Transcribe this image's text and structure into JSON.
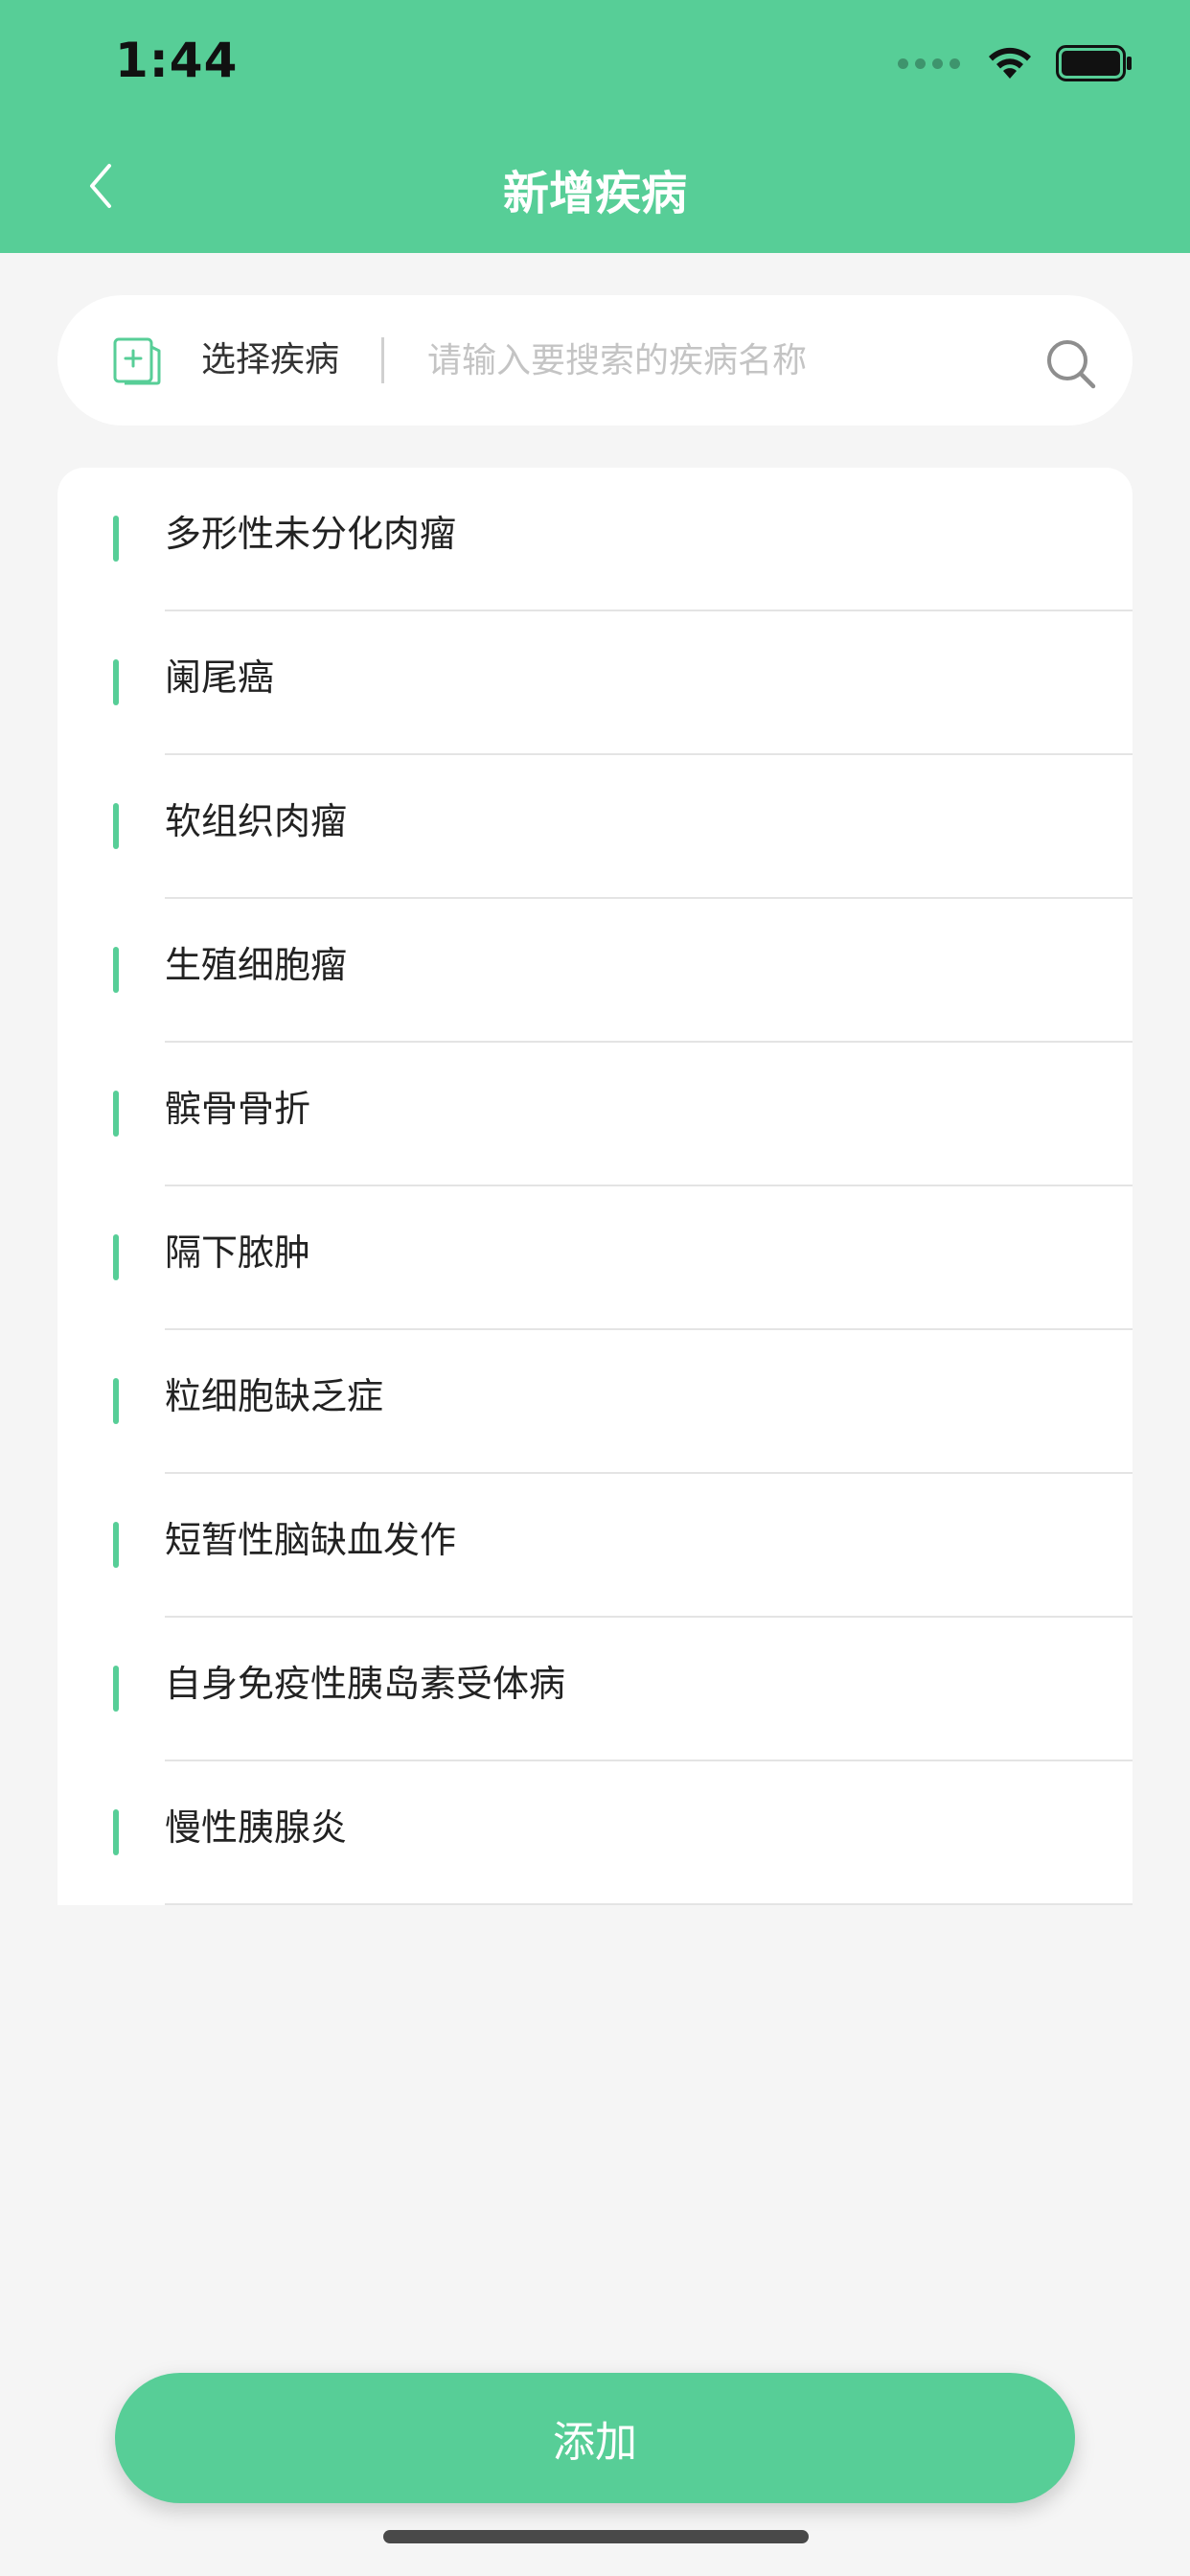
{
  "status_bar": {
    "time": "1:44"
  },
  "header": {
    "title": "新增疾病"
  },
  "search": {
    "select_label": "选择疾病",
    "placeholder": "请输入要搜索的疾病名称",
    "value": ""
  },
  "diseases": [
    "多形性未分化肉瘤",
    "阑尾癌",
    "软组织肉瘤",
    "生殖细胞瘤",
    "髌骨骨折",
    "隔下脓肿",
    "粒细胞缺乏症",
    "短暂性脑缺血发作",
    "自身免疫性胰岛素受体病",
    "慢性胰腺炎"
  ],
  "footer": {
    "add_label": "添加"
  },
  "colors": {
    "accent": "#57ce97",
    "background": "#f5f5f5"
  }
}
